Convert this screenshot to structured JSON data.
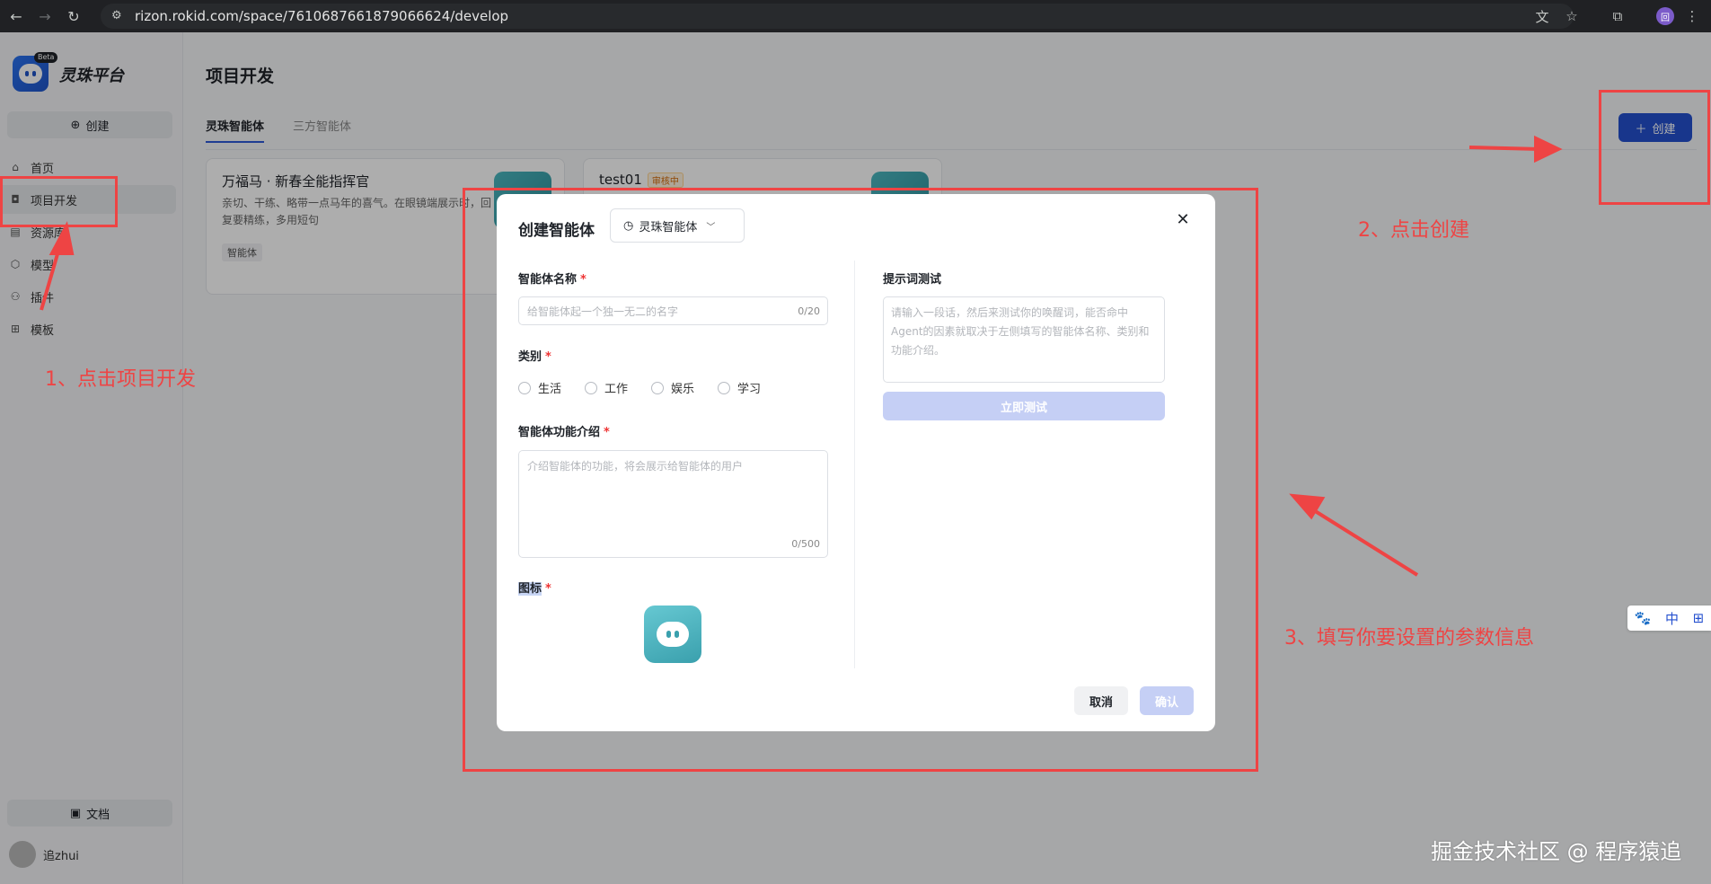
{
  "browser": {
    "url": "rizon.rokid.com/space/7610687661879066624/develop",
    "profile_initial": "回"
  },
  "sidebar": {
    "brand_name": "灵珠平台",
    "beta_label": "Beta",
    "create_label": "创建",
    "items": [
      {
        "label": "首页",
        "icon": "home-icon"
      },
      {
        "label": "项目开发",
        "icon": "robot-icon"
      },
      {
        "label": "资源库",
        "icon": "library-icon"
      },
      {
        "label": "模型",
        "icon": "model-icon"
      },
      {
        "label": "插件",
        "icon": "plugin-icon"
      },
      {
        "label": "模板",
        "icon": "template-icon"
      }
    ],
    "docs_label": "文档",
    "username": "追zhui"
  },
  "main": {
    "title": "项目开发",
    "tabs": [
      {
        "label": "灵珠智能体",
        "active": true
      },
      {
        "label": "三方智能体",
        "active": false
      }
    ],
    "create_label": "创建",
    "cards": [
      {
        "title": "万福马 · 新春全能指挥官",
        "desc": "亲切、干练、略带一点马年的喜气。在眼镜端展示时，回复要精练，多用短句",
        "tag": "智能体"
      },
      {
        "title": "test01",
        "status": "审核中"
      }
    ]
  },
  "modal": {
    "title": "创建智能体",
    "type_select": "灵珠智能体",
    "name_label": "智能体名称",
    "name_placeholder": "给智能体起一个独一无二的名字",
    "name_counter": "0/20",
    "category_label": "类别",
    "categories": [
      "生活",
      "工作",
      "娱乐",
      "学习"
    ],
    "intro_label": "智能体功能介绍",
    "intro_placeholder": "介绍智能体的功能，将会展示给智能体的用户",
    "intro_counter": "0/500",
    "icon_label": "图标",
    "required_mark": "*",
    "prompt_label": "提示词测试",
    "prompt_placeholder": "请输入一段话，然后来测试你的唤醒词，能否命中Agent的因素就取决于左侧填写的智能体名称、类别和功能介绍。",
    "test_button": "立即测试",
    "cancel_button": "取消",
    "confirm_button": "确认"
  },
  "annotations": {
    "step1": "1、点击项目开发",
    "step2": "2、点击创建",
    "step3": "3、填写你要设置的参数信息",
    "color": "#ee4444"
  },
  "ime": {
    "label": "中"
  },
  "watermark": "掘金技术社区 @ 程序猿追",
  "colors": {
    "primary": "#2450cf",
    "disabled_primary": "#c5cff5",
    "required": "#e33"
  }
}
